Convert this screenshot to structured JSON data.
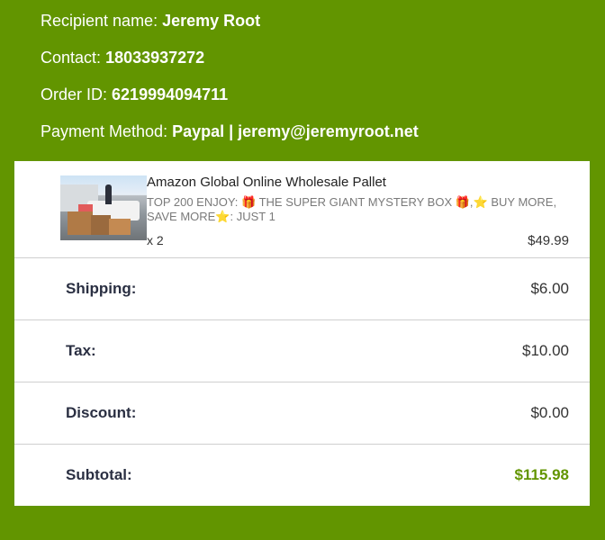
{
  "recipient": {
    "name_label": "Recipient name:",
    "name": "Jeremy Root",
    "contact_label": "Contact:",
    "contact": "18033937272",
    "order_label": "Order ID:",
    "order_id": "6219994094711",
    "payment_label": "Payment Method:",
    "payment": "Paypal | jeremy@jeremyroot.net"
  },
  "product": {
    "title": "Amazon Global Online Wholesale Pallet",
    "description": "TOP 200 ENJOY: 🎁 THE SUPER GIANT MYSTERY BOX 🎁,⭐ BUY MORE, SAVE MORE⭐: JUST 1",
    "quantity": "x 2",
    "price": "$49.99"
  },
  "summary": {
    "shipping_label": "Shipping:",
    "shipping": "$6.00",
    "tax_label": "Tax:",
    "tax": "$10.00",
    "discount_label": "Discount:",
    "discount": "$0.00",
    "subtotal_label": "Subtotal:",
    "subtotal": "$115.98"
  },
  "colors": {
    "background": "#629500",
    "accent": "#629500"
  }
}
